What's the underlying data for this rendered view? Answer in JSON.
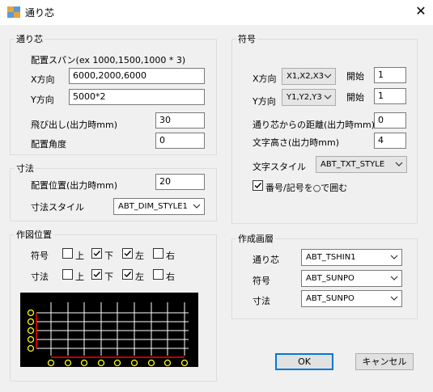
{
  "window": {
    "title": "通り芯",
    "close_icon": "close-icon"
  },
  "grid_group": {
    "label": "通り芯",
    "span_label": "配置スパン(ex 1000,1500,1000 * 3)",
    "x_label": "X方向",
    "x_value": "6000,2000,6000",
    "y_label": "Y方向",
    "y_value": "5000*2",
    "overhang_label": "飛び出し(出力時mm)",
    "overhang_value": "30",
    "angle_label": "配置角度",
    "angle_value": "0"
  },
  "dim_group": {
    "label": "寸法",
    "offset_label": "配置位置(出力時mm)",
    "offset_value": "20",
    "style_label": "寸法スタイル",
    "style_value": "ABT_DIM_STYLE1"
  },
  "placement_group": {
    "label": "作図位置",
    "rows": [
      {
        "label": "符号",
        "top": "上",
        "top_checked": false,
        "bottom": "下",
        "bottom_checked": true,
        "left": "左",
        "left_checked": true,
        "right": "右",
        "right_checked": false
      },
      {
        "label": "寸法",
        "top": "上",
        "top_checked": false,
        "bottom": "下",
        "bottom_checked": true,
        "left": "左",
        "left_checked": true,
        "right": "右",
        "right_checked": false
      }
    ]
  },
  "symbol_group": {
    "label": "符号",
    "x_label": "X方向",
    "x_combo": "X1,X2,X3",
    "x_start_label": "開始",
    "x_start_value": "1",
    "y_label": "Y方向",
    "y_combo": "Y1,Y2,Y3",
    "y_start_label": "開始",
    "y_start_value": "1",
    "distance_label": "通り芯からの距離(出力時mm)",
    "distance_value": "0",
    "text_height_label": "文字高さ(出力時mm)",
    "text_height_value": "4",
    "text_style_label": "文字スタイル",
    "text_style_value": "ABT_TXT_STYLE",
    "circle_label": "番号/記号を○で囲む",
    "circle_checked": true
  },
  "layer_group": {
    "label": "作成画層",
    "grid_label": "通り芯",
    "grid_value": "ABT_TSHIN1",
    "symbol_label": "符号",
    "symbol_value": "ABT_SUNPO",
    "dim_label": "寸法",
    "dim_value": "ABT_SUNPO"
  },
  "buttons": {
    "ok": "OK",
    "cancel": "キャンセル"
  },
  "colors": {
    "preview_bg": "#000000",
    "grid_line": "#ffffff",
    "marker": "#ffff00",
    "dim_line": "#ff0000",
    "default_border": "#0078d7"
  }
}
